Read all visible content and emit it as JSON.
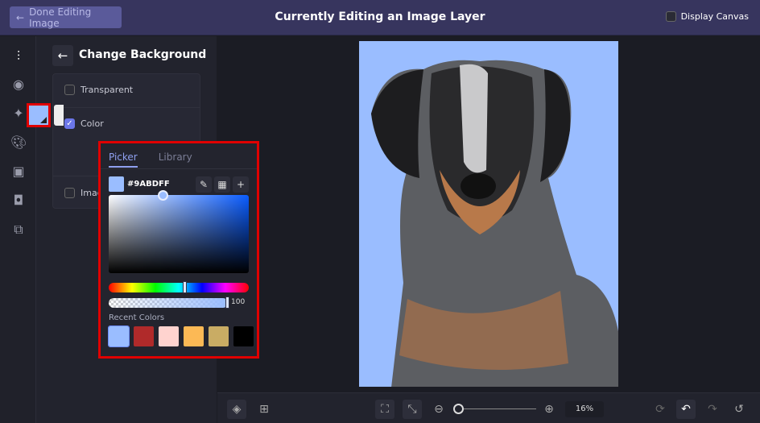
{
  "topbar": {
    "done_label": "Done Editing Image",
    "title": "Currently Editing an Image Layer",
    "display_canvas_label": "Display Canvas",
    "display_canvas_checked": false
  },
  "rail": {
    "icons": [
      "adjustments-icon",
      "eye-icon",
      "sparkle-icon",
      "palette-icon",
      "frame-icon",
      "mask-icon",
      "overlay-icon"
    ]
  },
  "panel": {
    "title": "Change Background",
    "options": [
      {
        "label": "Transparent",
        "checked": false
      },
      {
        "label": "Color",
        "checked": true
      },
      {
        "label": "Image",
        "checked": false
      }
    ]
  },
  "picker": {
    "tabs": [
      "Picker",
      "Library"
    ],
    "active_tab": "Picker",
    "hex": "#9ABDFF",
    "alpha": "100",
    "recent_label": "Recent Colors",
    "recent_colors": [
      "#9ABDFF",
      "#B02A2A",
      "#FFD3CF",
      "#FCB955",
      "#C9AC64",
      "#000000"
    ]
  },
  "canvas": {
    "background": "#9ABDFF"
  },
  "bottombar": {
    "zoom": "16%"
  },
  "colors": {
    "topbar": "#37355e",
    "accent": "#6b76e8",
    "highlight": "#e00000"
  }
}
